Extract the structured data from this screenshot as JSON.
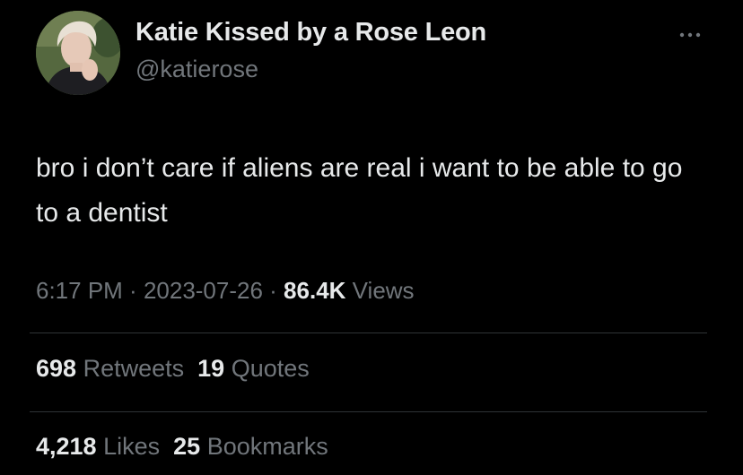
{
  "author": {
    "display_name": "Katie Kissed by a Rose Leon",
    "handle": "@katierose",
    "avatar_icon": "profile-photo"
  },
  "more_icon": "more-horizontal-icon",
  "tweet": {
    "text": "bro i don’t care if aliens are real i want to be able to go to a dentist"
  },
  "meta": {
    "time": "6:17 PM",
    "separator": " · ",
    "date": "2023-07-26",
    "views_count": "86.4K",
    "views_label": "Views"
  },
  "stats_row_1": {
    "retweets_count": "698",
    "retweets_label": "Retweets",
    "quotes_count": "19",
    "quotes_label": "Quotes"
  },
  "stats_row_2": {
    "likes_count": "4,218",
    "likes_label": "Likes",
    "bookmarks_count": "25",
    "bookmarks_label": "Bookmarks"
  },
  "colors": {
    "background": "#000000",
    "primary_text": "#e7e9ea",
    "secondary_text": "#71767b",
    "divider": "#2f3336"
  }
}
